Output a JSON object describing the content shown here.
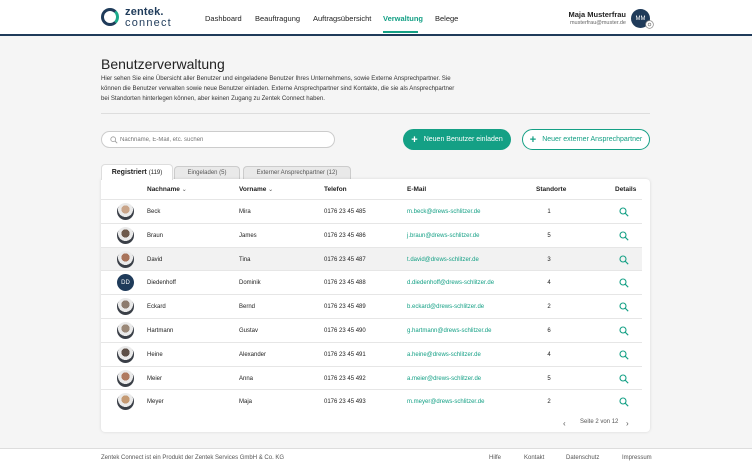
{
  "brand": {
    "line1": "zentek.",
    "line2": "connect"
  },
  "nav": [
    {
      "label": "Dashboard"
    },
    {
      "label": "Beauftragung"
    },
    {
      "label": "Auftragsübersicht"
    },
    {
      "label": "Verwaltung"
    },
    {
      "label": "Belege"
    }
  ],
  "user": {
    "name": "Maja Musterfrau",
    "email": "musterfrau@muster.de",
    "initials": "MM"
  },
  "page": {
    "title": "Benutzerverwaltung",
    "description": "Hier sehen Sie eine Übersicht aller Benutzer und eingeladene Benutzer Ihres Unternehmens, sowie Externe Ansprechpartner. Sie können die Benutzer verwalten sowie neue Benutzer einladen. Externe Ansprechpartner sind Kontakte, die sie als Ansprechpartner bei Standorten hinterlegen können, aber keinen Zugang zu Zentek Connect haben."
  },
  "search": {
    "placeholder": "Nachname, E-Mail, etc. suchen"
  },
  "actions": {
    "invite": "Neuen Benutzer einladen",
    "external": "Neuer externer Ansprechpartner"
  },
  "tabs": {
    "registered": "Registriert",
    "registered_count": "(119)",
    "invited": "Eingeladen (5)",
    "external": "Externer Ansprechpartner (12)"
  },
  "columns": {
    "lastname": "Nachname",
    "firstname": "Vorname",
    "phone": "Telefon",
    "email": "E-Mail",
    "sites": "Standorte",
    "details": "Details"
  },
  "rows": [
    {
      "lastname": "Beck",
      "firstname": "Mira",
      "phone": "0176 23 45 485",
      "email": "m.beck@drews-schlitzer.de",
      "sites": "1",
      "avatar": "photo",
      "color": "#c9a58a"
    },
    {
      "lastname": "Braun",
      "firstname": "James",
      "phone": "0176 23 45 486",
      "email": "j.braun@drews-schlitzer.de",
      "sites": "5",
      "avatar": "photo",
      "color": "#6e5a4c"
    },
    {
      "lastname": "David",
      "firstname": "Tina",
      "phone": "0176 23 45 487",
      "email": "t.david@drews-schlitzer.de",
      "sites": "3",
      "avatar": "photo",
      "color": "#a8735a"
    },
    {
      "lastname": "Diedenhoff",
      "firstname": "Dominik",
      "phone": "0176 23 45 488",
      "email": "d.diedenhoff@drews-schlitzer.de",
      "sites": "4",
      "avatar": "DD",
      "color": "#1f3b5a"
    },
    {
      "lastname": "Eckard",
      "firstname": "Bernd",
      "phone": "0176 23 45 489",
      "email": "b.eckard@drews-schlitzer.de",
      "sites": "2",
      "avatar": "photo",
      "color": "#8d7b6e"
    },
    {
      "lastname": "Hartmann",
      "firstname": "Gustav",
      "phone": "0176 23 45 490",
      "email": "g.hartmann@drews-schlitzer.de",
      "sites": "6",
      "avatar": "photo",
      "color": "#9a8878"
    },
    {
      "lastname": "Heine",
      "firstname": "Alexander",
      "phone": "0176 23 45 491",
      "email": "a.heine@drews-schlitzer.de",
      "sites": "4",
      "avatar": "photo",
      "color": "#5d4f47"
    },
    {
      "lastname": "Meier",
      "firstname": "Anna",
      "phone": "0176 23 45 492",
      "email": "a.meier@drews-schlitzer.de",
      "sites": "5",
      "avatar": "photo",
      "color": "#b07a60"
    },
    {
      "lastname": "Meyer",
      "firstname": "Maja",
      "phone": "0176 23 45 493",
      "email": "m.meyer@drews-schlitzer.de",
      "sites": "2",
      "avatar": "photo",
      "color": "#c49a74"
    }
  ],
  "pagination": {
    "label": "Seite 2 von 12"
  },
  "footer": {
    "copyright": "Zentek Connect ist ein Produkt der Zentek Services GmbH & Co. KG",
    "links": [
      "Hilfe",
      "Kontakt",
      "Datenschutz",
      "Impressum"
    ]
  },
  "colors": {
    "accent": "#14a085",
    "navy": "#1f3b5a"
  }
}
